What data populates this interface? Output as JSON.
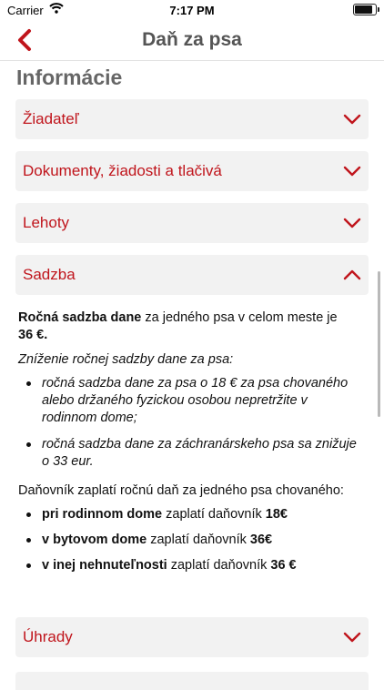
{
  "status_bar": {
    "carrier": "Carrier",
    "time": "7:17 PM",
    "battery_level": 0.95
  },
  "navbar": {
    "title": "Daň za psa",
    "back_icon": "chevron-left-icon"
  },
  "section_title": "Informácie",
  "accordion": [
    {
      "label": "Žiadateľ",
      "expanded": false
    },
    {
      "label": "Dokumenty, žiadosti a tlačivá",
      "expanded": false
    },
    {
      "label": "Lehoty",
      "expanded": false
    },
    {
      "label": "Sadzba",
      "expanded": true
    },
    {
      "label": "Úhrady",
      "expanded": false
    }
  ],
  "sadzba": {
    "p1_bold1": "Ročná sadzba dane",
    "p1_text": " za jedného psa v celom meste je ",
    "p1_bold2": "36 €.",
    "reduction_title": "Zníženie ročnej sadzby dane za psa:",
    "reductions": [
      "ročná sadzba dane za psa o 18 € za psa chovaného alebo držaného fyzickou osobou nepretržite v rodinnom dome;",
      "ročná sadzba dane za záchranárskeho psa sa znižuje o 33 eur."
    ],
    "payer_title": "Daňovník zaplatí ročnú daň za jedného psa chovaného:",
    "payer_items": [
      {
        "bold": "pri rodinnom dome",
        "text": " zaplatí daňovník ",
        "amount": "18€"
      },
      {
        "bold": "v bytovom dome",
        "text": " zaplatí daňovník ",
        "amount": "36€"
      },
      {
        "bold": "v inej nehnuteľnosti",
        "text": " zaplatí daňovník ",
        "amount": "36 €"
      }
    ]
  },
  "colors": {
    "accent": "#c0151c",
    "header_panel": "#f2f2f2",
    "title_gray": "#666666"
  }
}
